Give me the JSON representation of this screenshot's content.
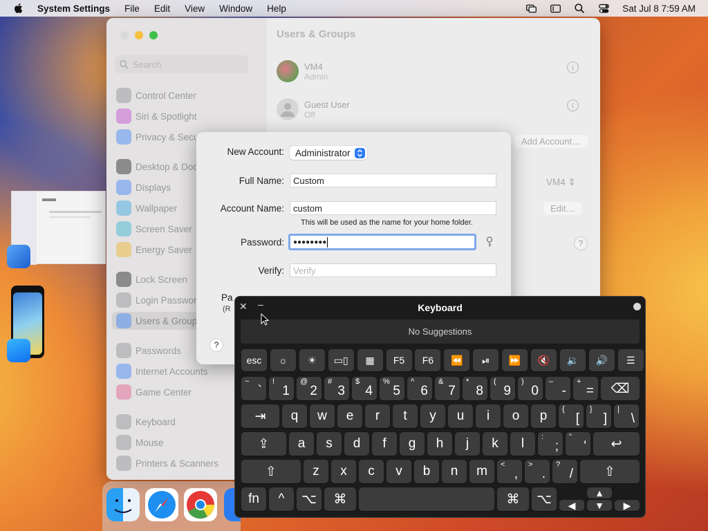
{
  "menubar": {
    "app_name": "System Settings",
    "items": [
      "File",
      "Edit",
      "View",
      "Window",
      "Help"
    ],
    "datetime": "Sat Jul 8  7:59 AM"
  },
  "settings": {
    "title": "Users & Groups",
    "search_placeholder": "Search",
    "sidebar": [
      {
        "label": "Control Center",
        "icon": "control-center-icon",
        "color": "#8e8e93"
      },
      {
        "label": "Siri & Spotlight",
        "icon": "siri-icon",
        "color": "#c04bd0"
      },
      {
        "label": "Privacy & Secu",
        "icon": "privacy-hand-icon",
        "color": "#3c82f6"
      },
      {
        "label": "Desktop & Doc",
        "icon": "desktop-dock-icon",
        "color": "#222222"
      },
      {
        "label": "Displays",
        "icon": "displays-sun-icon",
        "color": "#3c82f6"
      },
      {
        "label": "Wallpaper",
        "icon": "wallpaper-icon",
        "color": "#37a7e0"
      },
      {
        "label": "Screen Saver",
        "icon": "screen-saver-icon",
        "color": "#37b3d0"
      },
      {
        "label": "Energy Saver",
        "icon": "energy-bulb-icon",
        "color": "#f0b429"
      },
      {
        "label": "Lock Screen",
        "icon": "lock-icon",
        "color": "#222222"
      },
      {
        "label": "Login Passwor",
        "icon": "login-password-icon",
        "color": "#8e8e93"
      },
      {
        "label": "Users & Group",
        "icon": "users-icon",
        "color": "#3c82f6"
      },
      {
        "label": "Passwords",
        "icon": "key-icon",
        "color": "#8e8e93"
      },
      {
        "label": "Internet Accounts",
        "icon": "at-icon",
        "color": "#3c82f6"
      },
      {
        "label": "Game Center",
        "icon": "game-center-icon",
        "color": "#e25b8a"
      },
      {
        "label": "Keyboard",
        "icon": "keyboard-icon",
        "color": "#8e8e93"
      },
      {
        "label": "Mouse",
        "icon": "mouse-icon",
        "color": "#8e8e93"
      },
      {
        "label": "Printers & Scanners",
        "icon": "printer-icon",
        "color": "#8e8e93"
      }
    ],
    "users": [
      {
        "name": "VM4",
        "role": "Admin"
      },
      {
        "name": "Guest User",
        "role": "Off"
      }
    ],
    "add_account": "Add Account…",
    "vm4_select": "VM4",
    "edit": "Edit…",
    "help": "?"
  },
  "sheet": {
    "new_account_label": "New Account:",
    "new_account_value": "Administrator",
    "full_name_label": "Full Name:",
    "full_name_value": "Custom",
    "account_name_label": "Account Name:",
    "account_name_value": "custom",
    "account_hint": "This will be used as the name for your home folder.",
    "password_label": "Password:",
    "password_value": "●●●●●●●●",
    "verify_label": "Verify:",
    "verify_placeholder": "Verify",
    "hint_label_partial": "Pa",
    "hint_label_partial2": "(R",
    "help": "?"
  },
  "keyboard": {
    "title": "Keyboard",
    "suggestions": "No Suggestions",
    "fn_row": [
      "esc",
      "☼",
      "☀",
      "▭▯",
      "▦",
      "F5",
      "F6",
      "⏪",
      "⏯",
      "⏩",
      "🔇",
      "🔉",
      "🔊",
      "☰"
    ],
    "row1": [
      {
        "top": "~",
        "main": "`"
      },
      {
        "top": "!",
        "main": "1"
      },
      {
        "top": "@",
        "main": "2"
      },
      {
        "top": "#",
        "main": "3"
      },
      {
        "top": "$",
        "main": "4"
      },
      {
        "top": "%",
        "main": "5"
      },
      {
        "top": "^",
        "main": "6"
      },
      {
        "top": "&",
        "main": "7"
      },
      {
        "top": "*",
        "main": "8"
      },
      {
        "top": "(",
        "main": "9"
      },
      {
        "top": ")",
        "main": "0"
      },
      {
        "top": "–",
        "main": "-"
      },
      {
        "top": "+",
        "main": "="
      }
    ],
    "row2": [
      "q",
      "w",
      "e",
      "r",
      "t",
      "y",
      "u",
      "i",
      "o",
      "p"
    ],
    "row2_extra": [
      {
        "top": "{",
        "main": "["
      },
      {
        "top": "}",
        "main": "]"
      },
      {
        "top": "|",
        "main": "\\"
      }
    ],
    "row3": [
      "a",
      "s",
      "d",
      "f",
      "g",
      "h",
      "j",
      "k",
      "l"
    ],
    "row3_extra": [
      {
        "top": ":",
        "main": ";"
      },
      {
        "top": "\"",
        "main": "'"
      }
    ],
    "row4": [
      "z",
      "x",
      "c",
      "v",
      "b",
      "n",
      "m"
    ],
    "row4_extra": [
      {
        "top": "<",
        "main": ","
      },
      {
        "top": ">",
        "main": "."
      },
      {
        "top": "?",
        "main": "/"
      }
    ],
    "special": {
      "tab": "⇥",
      "caps": "⇪",
      "delete": "⌫",
      "return": "↩",
      "shift": "⇧",
      "fn": "fn",
      "control": "^",
      "option": "⌥",
      "command": "⌘",
      "up": "▲",
      "down": "▼",
      "left": "◀",
      "right": "▶"
    }
  }
}
